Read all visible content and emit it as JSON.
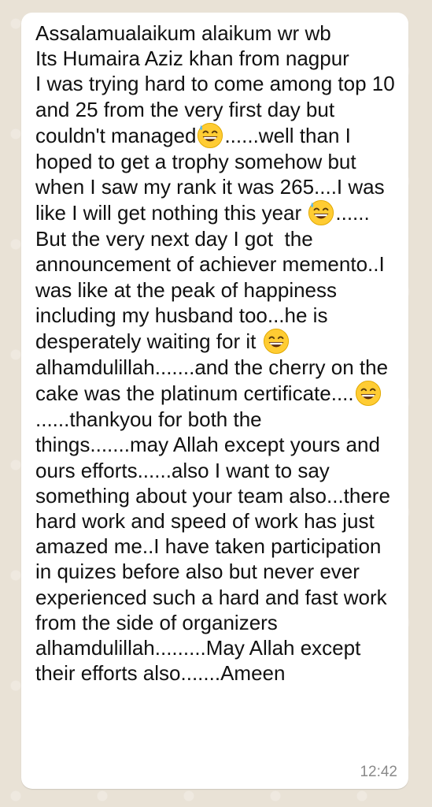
{
  "message": {
    "segments": [
      {
        "type": "text",
        "text": "Assalamualaikum alaikum wr wb\nIts Humaira Aziz khan from nagpur\nI was trying hard to come among top 10 and 25 from the very first day but couldn't managed"
      },
      {
        "type": "emoji",
        "icon": "grinning-sweat-emoji"
      },
      {
        "type": "text",
        "text": "......well than I hoped to get a trophy somehow but when I saw my rank it was 265....I was like I will get nothing this year "
      },
      {
        "type": "emoji",
        "icon": "grinning-sweat-emoji"
      },
      {
        "type": "text",
        "text": "......\nBut the very next day I got  the announcement of achiever memento..I was like at the peak of happiness including my husband too...he is desperately waiting for it "
      },
      {
        "type": "emoji",
        "icon": "grinning-smile-emoji"
      },
      {
        "type": "text",
        "text": "alhamdulillah.......and the cherry on the cake was the platinum certificate...."
      },
      {
        "type": "emoji",
        "icon": "grinning-smile-emoji"
      },
      {
        "type": "text",
        "text": "......thankyou for both the things.......may Allah except yours and ours efforts......also I want to say something about your team also...there hard work and speed of work has just amazed me..I have taken participation in quizes before also but never ever experienced such a hard and fast work from the side of organizers alhamdulillah.........May Allah except their efforts also.......Ameen"
      }
    ],
    "time": "12:42"
  }
}
